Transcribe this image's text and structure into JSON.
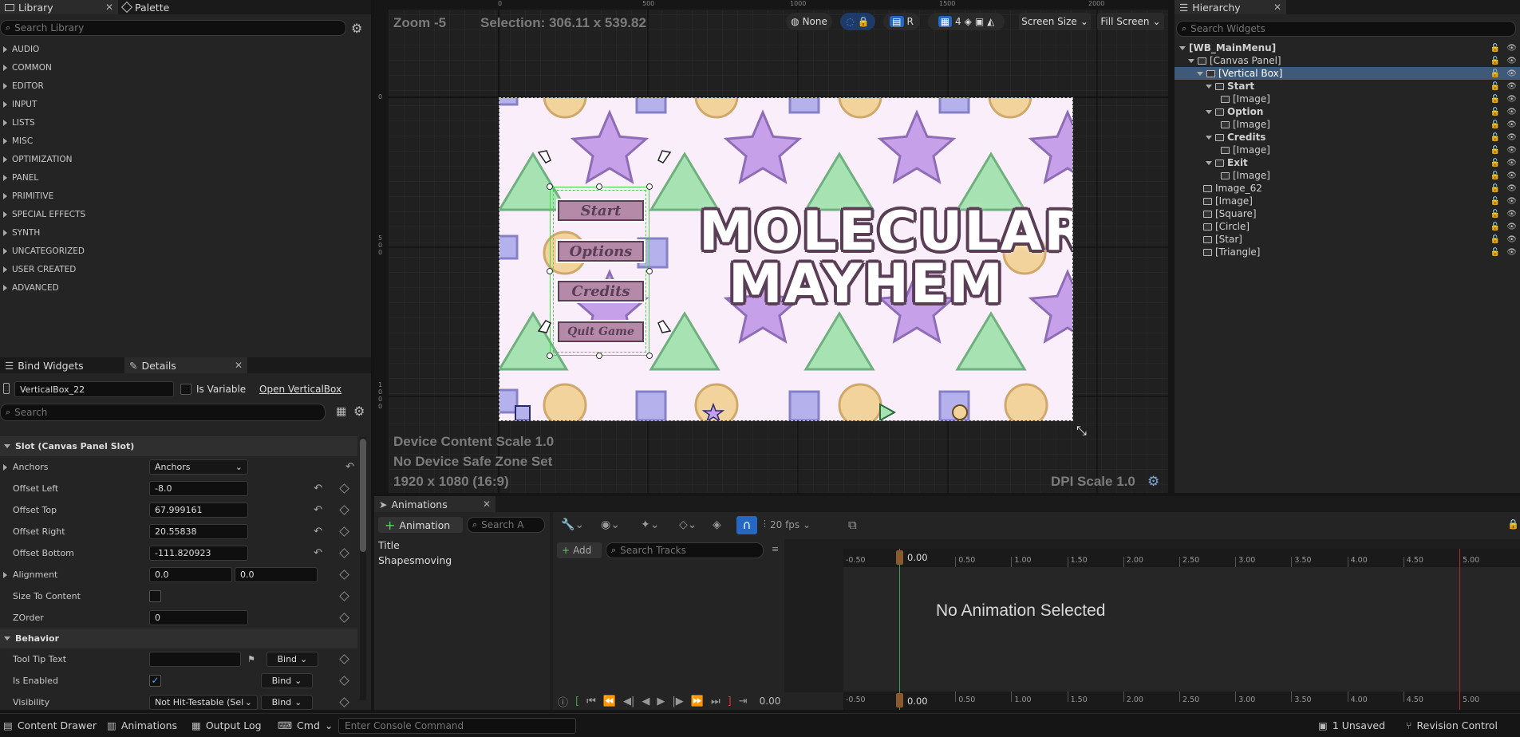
{
  "library": {
    "tab_library": "Library",
    "tab_palette": "Palette",
    "search_placeholder": "Search Library",
    "categories": [
      "AUDIO",
      "COMMON",
      "EDITOR",
      "INPUT",
      "LISTS",
      "MISC",
      "OPTIMIZATION",
      "PANEL",
      "PRIMITIVE",
      "SPECIAL EFFECTS",
      "SYNTH",
      "UNCATEGORIZED",
      "USER CREATED",
      "ADVANCED"
    ]
  },
  "details": {
    "tab_bind": "Bind Widgets",
    "tab_details": "Details",
    "widget_name": "VerticalBox_22",
    "is_variable": "Is Variable",
    "open_link": "Open VerticalBox",
    "search_placeholder": "Search",
    "section_slot": "Slot (Canvas Panel Slot)",
    "anchors_label": "Anchors",
    "anchors_value": "Anchors",
    "offset_left_label": "Offset Left",
    "offset_left": "-8.0",
    "offset_top_label": "Offset Top",
    "offset_top": "67.999161",
    "offset_right_label": "Offset Right",
    "offset_right": "20.55838",
    "offset_bottom_label": "Offset Bottom",
    "offset_bottom": "-111.820923",
    "alignment_label": "Alignment",
    "alignment_x": "0.0",
    "alignment_y": "0.0",
    "size_to_content_label": "Size To Content",
    "zorder_label": "ZOrder",
    "zorder": "0",
    "section_behavior": "Behavior",
    "tooltip_label": "Tool Tip Text",
    "is_enabled_label": "Is Enabled",
    "visibility_label": "Visibility",
    "visibility_value": "Not Hit-Testable (Sel",
    "bind_label": "Bind"
  },
  "viewport": {
    "zoom": "Zoom -5",
    "selection": "Selection: 306.11 x 539.82",
    "none_label": "None",
    "r_label": "R",
    "grid_num": "4",
    "screen_size": "Screen Size",
    "fill_screen": "Fill Screen",
    "ruler_top": [
      "0",
      "500",
      "1000",
      "1500",
      "2000"
    ],
    "ruler_left": [
      "0",
      "5\n0\n0",
      "1\n0\n0\n0"
    ],
    "device_scale": "Device Content Scale 1.0",
    "safe_zone": "No Device Safe Zone Set",
    "resolution": "1920 x 1080 (16:9)",
    "dpi_scale": "DPI Scale 1.0",
    "game_title_1": "MOLECULAR",
    "game_title_2": "MAYHEM",
    "menu_buttons": [
      "Start",
      "Options",
      "Credits",
      "Quit Game"
    ]
  },
  "hierarchy": {
    "tab": "Hierarchy",
    "search_placeholder": "Search Widgets",
    "rows": [
      {
        "label": "[WB_MainMenu]",
        "indent": 0,
        "bold": true,
        "expand": true,
        "icon": false
      },
      {
        "label": "[Canvas Panel]",
        "indent": 1,
        "bold": false,
        "expand": true,
        "icon": true
      },
      {
        "label": "[Vertical Box]",
        "indent": 2,
        "bold": false,
        "expand": true,
        "icon": true,
        "selected": true
      },
      {
        "label": "Start",
        "indent": 3,
        "bold": true,
        "expand": true,
        "icon": true
      },
      {
        "label": "[Image]",
        "indent": 4,
        "bold": false,
        "expand": false,
        "icon": true
      },
      {
        "label": "Option",
        "indent": 3,
        "bold": true,
        "expand": true,
        "icon": true
      },
      {
        "label": "[Image]",
        "indent": 4,
        "bold": false,
        "expand": false,
        "icon": true
      },
      {
        "label": "Credits",
        "indent": 3,
        "bold": true,
        "expand": true,
        "icon": true
      },
      {
        "label": "[Image]",
        "indent": 4,
        "bold": false,
        "expand": false,
        "icon": true
      },
      {
        "label": "Exit",
        "indent": 3,
        "bold": true,
        "expand": true,
        "icon": true
      },
      {
        "label": "[Image]",
        "indent": 4,
        "bold": false,
        "expand": false,
        "icon": true
      },
      {
        "label": "Image_62",
        "indent": 2,
        "bold": false,
        "expand": false,
        "icon": true
      },
      {
        "label": "[Image]",
        "indent": 2,
        "bold": false,
        "expand": false,
        "icon": true
      },
      {
        "label": "[Square]",
        "indent": 2,
        "bold": false,
        "expand": false,
        "icon": true
      },
      {
        "label": "[Circle]",
        "indent": 2,
        "bold": false,
        "expand": false,
        "icon": true
      },
      {
        "label": "[Star]",
        "indent": 2,
        "bold": false,
        "expand": false,
        "icon": true
      },
      {
        "label": "[Triangle]",
        "indent": 2,
        "bold": false,
        "expand": false,
        "icon": true
      }
    ]
  },
  "animations": {
    "tab": "Animations",
    "add_button": "Animation",
    "search_placeholder": "Search A",
    "items": [
      "Title",
      "Shapesmoving"
    ],
    "fps": "20 fps",
    "add_track": "Add",
    "search_tracks": "Search Tracks",
    "time_start": "-0.50",
    "time_current": "0.00",
    "ticks": [
      "0.50",
      "1.00",
      "1.50",
      "2.00",
      "2.50",
      "3.00",
      "3.50",
      "4.00",
      "4.50",
      "5.00"
    ],
    "no_animation": "No Animation Selected",
    "playback_time": "0.00"
  },
  "statusbar": {
    "content_drawer": "Content Drawer",
    "animations": "Animations",
    "output_log": "Output Log",
    "cmd": "Cmd",
    "console_placeholder": "Enter Console Command",
    "unsaved": "1 Unsaved",
    "revision": "Revision Control"
  },
  "colors": {
    "accent": "#2468c4",
    "selection": "#3e5a78",
    "game_bg": "#fbeefb",
    "star": "#c6a0e8",
    "triangle": "#a7e3b2",
    "circle": "#f2d39c",
    "square": "#b5b1ec",
    "title": "#5a3e56",
    "button": "#b48aa8"
  }
}
